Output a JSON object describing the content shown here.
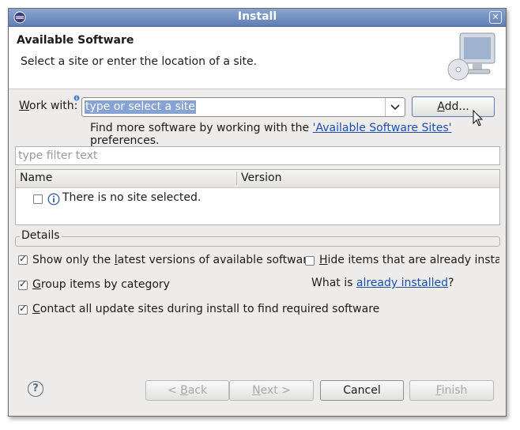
{
  "window": {
    "title": "Install",
    "close_icon": "close-icon"
  },
  "header": {
    "title": "Available Software",
    "subtitle": "Select a site or enter the location of a site."
  },
  "work_with": {
    "label_mnemonic": "W",
    "label_rest": "ork with:",
    "value": "type or select a site",
    "add_button": {
      "mnemonic": "A",
      "rest": "dd..."
    },
    "hint_before": "Find more software by working with the ",
    "hint_link": "'Available Software Sites'",
    "hint_after": " preferences."
  },
  "filter": {
    "placeholder": "type filter text"
  },
  "table": {
    "columns": [
      "Name",
      "Version"
    ],
    "empty_message": "There is no site selected."
  },
  "details": {
    "title": "Details",
    "opt_latest": {
      "before": "Show only the ",
      "mnemonic": "l",
      "after": "atest versions of available software",
      "checked": true
    },
    "opt_hide": {
      "mnemonic": "H",
      "after": "ide items that are already installe",
      "checked": false
    },
    "opt_group": {
      "mnemonic": "G",
      "after": "roup items by category",
      "checked": true
    },
    "what_is_before": "What is ",
    "what_is_link": "already installed",
    "what_is_after": "?",
    "opt_contact": {
      "mnemonic": "C",
      "after": "ontact all update sites during install to find required software",
      "checked": true
    }
  },
  "footer": {
    "back": {
      "prefix": "< ",
      "mnemonic": "B",
      "rest": "ack"
    },
    "next": {
      "mnemonic": "N",
      "rest": "ext >"
    },
    "cancel": "Cancel",
    "finish": {
      "mnemonic": "F",
      "rest": "inish"
    }
  },
  "colors": {
    "titlebar": "#6f8dc0",
    "selection": "#86a3d3",
    "link": "#1a4fb0"
  }
}
